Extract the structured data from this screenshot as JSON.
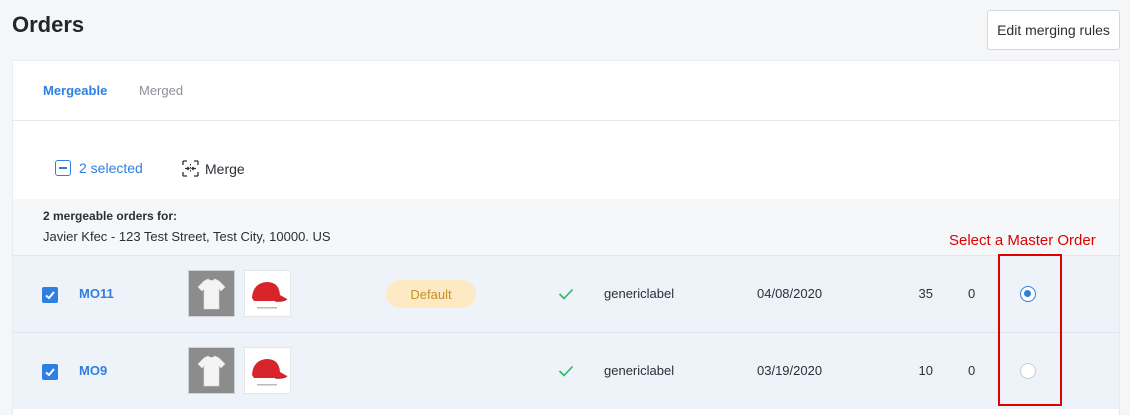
{
  "header": {
    "title": "Orders",
    "edit_button": "Edit merging rules"
  },
  "tabs": [
    {
      "label": "Mergeable",
      "active": true
    },
    {
      "label": "Merged",
      "active": false
    }
  ],
  "toolbar": {
    "selected_label": "2 selected",
    "merge_label": "Merge"
  },
  "group": {
    "title": "2 mergeable orders for:",
    "address": "Javier Kfec - 123 Test Street, Test City, 10000. US"
  },
  "orders": [
    {
      "id": "MO11",
      "badge": "Default",
      "carrier": "genericlabel",
      "date": "04/08/2020",
      "qty": "35",
      "other": "0",
      "checked": true,
      "master": true
    },
    {
      "id": "MO9",
      "badge": "",
      "carrier": "genericlabel",
      "date": "03/19/2020",
      "qty": "10",
      "other": "0",
      "checked": true,
      "master": false
    }
  ],
  "annotation": {
    "label": "Select a Master Order",
    "color": "#e00000"
  },
  "colors": {
    "accent": "#2f7fe0",
    "badge_bg": "#fde9c4",
    "badge_text": "#c4912a",
    "success": "#2db36a"
  }
}
